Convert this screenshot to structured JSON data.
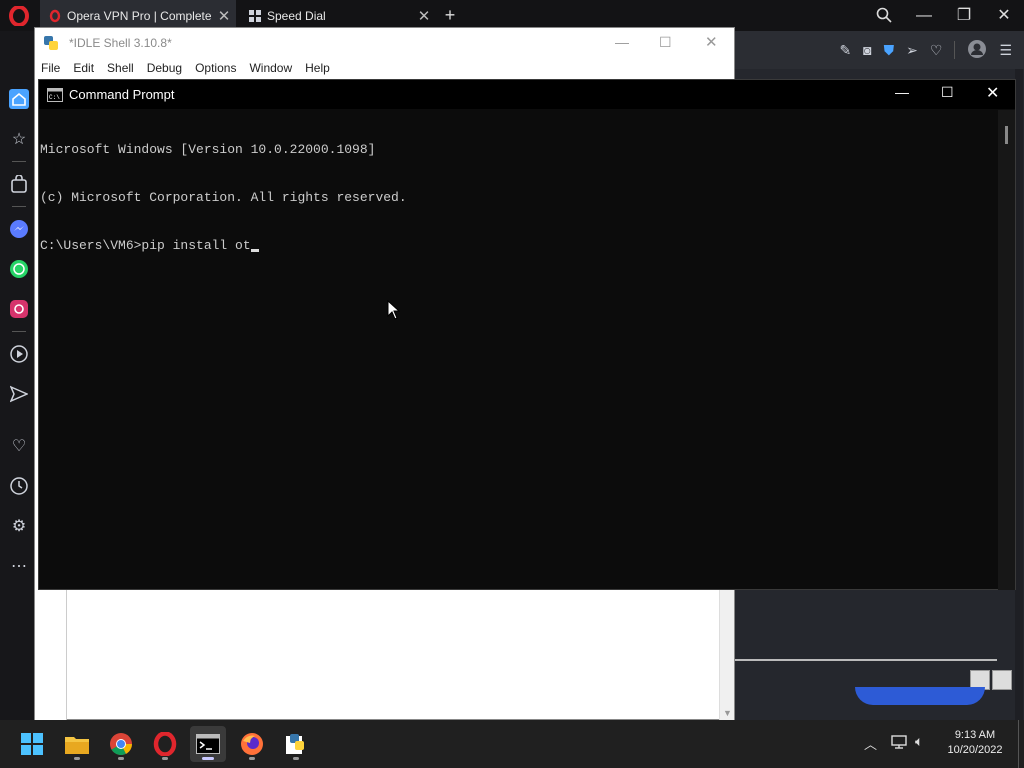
{
  "opera": {
    "tabs": [
      {
        "label": "Opera VPN Pro | Complete"
      },
      {
        "label": "Speed Dial"
      }
    ],
    "new_tab": "+"
  },
  "idle": {
    "title": "*IDLE Shell 3.10.8*",
    "menu": [
      "File",
      "Edit",
      "Shell",
      "Debug",
      "Options",
      "Window",
      "Help"
    ]
  },
  "cmd": {
    "title": "Command Prompt",
    "lines": [
      "Microsoft Windows [Version 10.0.22000.1098]",
      "(c) Microsoft Corporation. All rights reserved.",
      "C:\\Users\\VM6>pip install ot"
    ]
  },
  "taskbar": {
    "time": "9:13 AM",
    "date": "10/20/2022"
  },
  "colors": {
    "opera_red": "#e0262d",
    "accent_blue": "#4aa3ff",
    "taskbar_bg": "#202020"
  }
}
